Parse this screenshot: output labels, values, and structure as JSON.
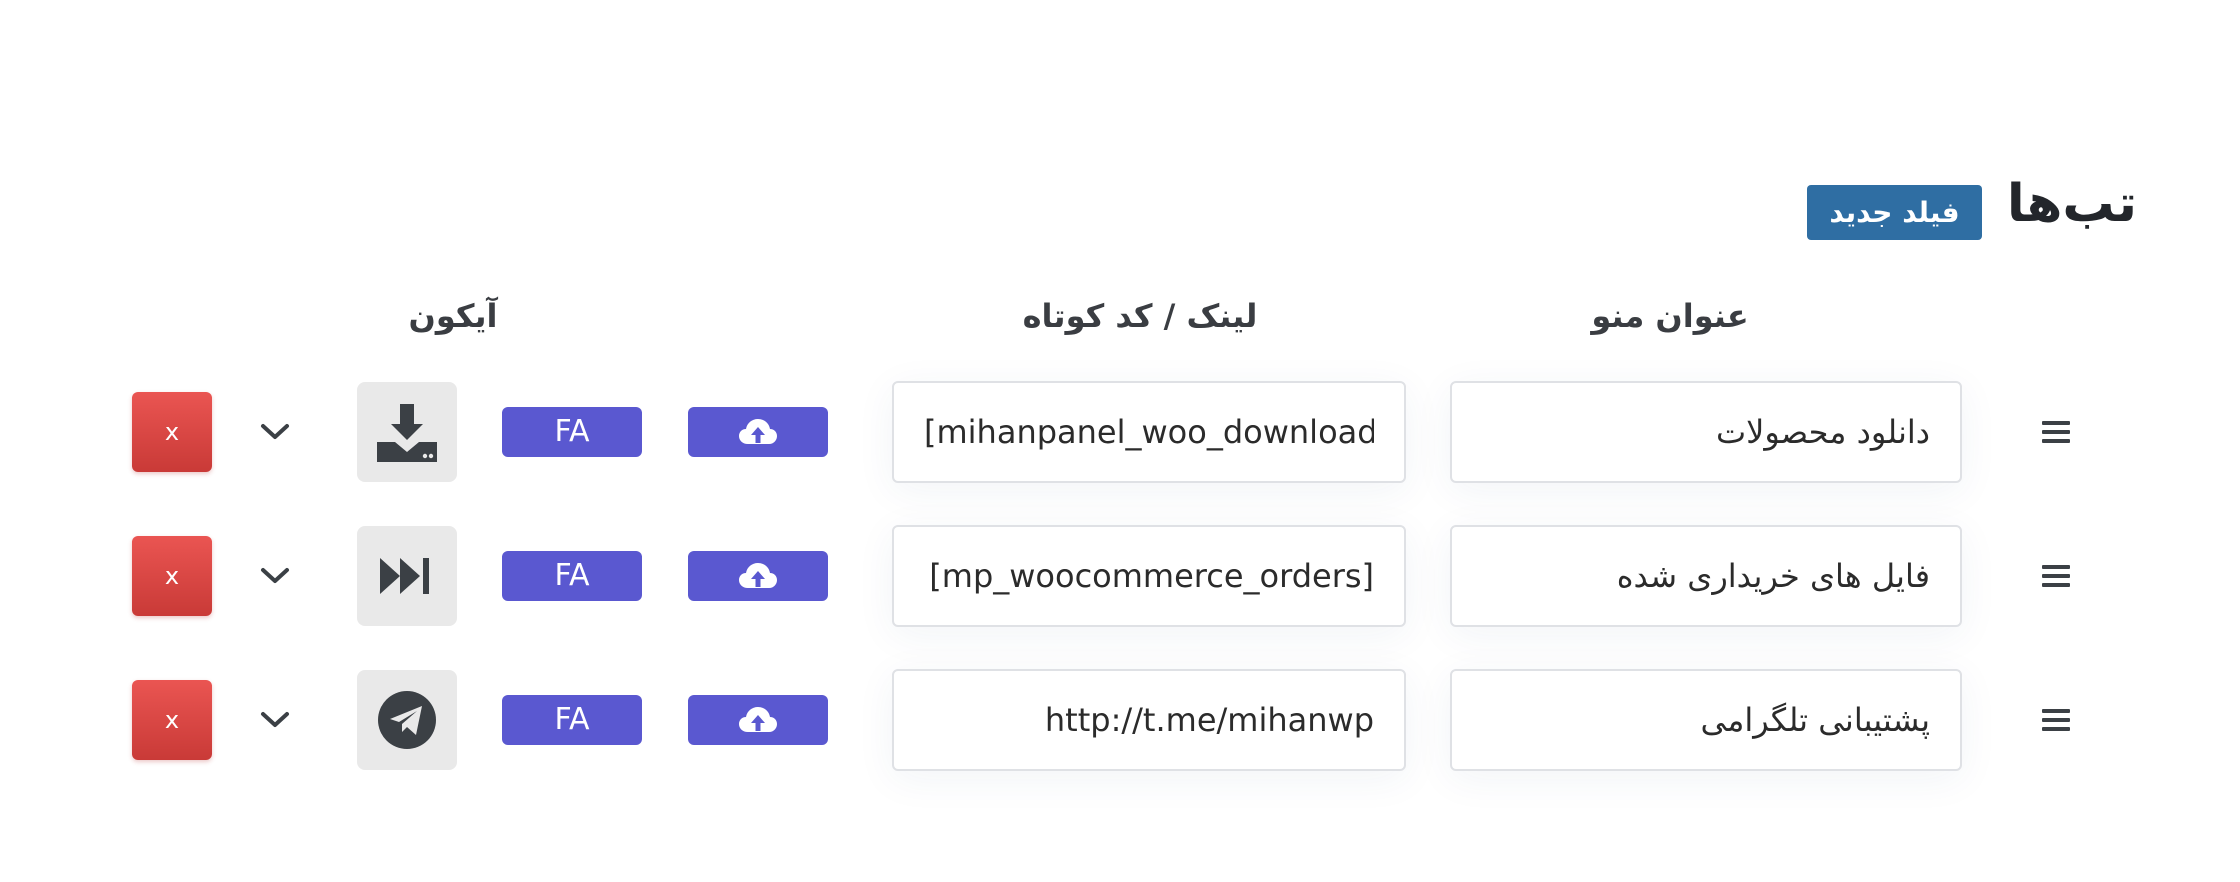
{
  "header": {
    "title": "تب‌ها",
    "new_field_label": "فیلد جدید"
  },
  "columns": {
    "menu_title": "عنوان منو",
    "link": "لینک / کد کوتاه",
    "icon": "آیکون"
  },
  "rows": [
    {
      "title": "دانلود محصولات",
      "link": "[mihanpanel_woo_downloads]",
      "fa_label": "FA",
      "icon": "download-icon",
      "delete_label": "x"
    },
    {
      "title": "فایل های خریداری شده",
      "link": "[mp_woocommerce_orders]",
      "fa_label": "FA",
      "icon": "fast-forward-icon",
      "delete_label": "x"
    },
    {
      "title": "پشتیبانی تلگرامی",
      "link": "http://t.me/mihanwp",
      "fa_label": "FA",
      "icon": "telegram-icon",
      "delete_label": "x"
    }
  ],
  "colors": {
    "primary_button": "#2f6ea3",
    "accent_button": "#5a58d0",
    "delete_button": "#d94441",
    "icon_box": "#e9e9e9",
    "icon_dark": "#3b4045"
  }
}
